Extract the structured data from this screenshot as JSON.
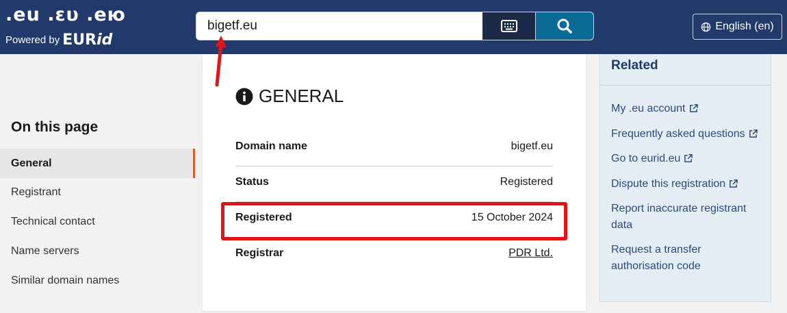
{
  "header": {
    "logo_tlds": ".eu .ευ .ею",
    "logo_powered": "Powered by",
    "logo_brand_main": "EUR",
    "logo_brand_italic": "id",
    "search_value": "bigetf.eu",
    "language_label": "English (en)"
  },
  "nav": {
    "title": "On this page",
    "items": [
      "General",
      "Registrant",
      "Technical contact",
      "Name servers",
      "Similar domain names"
    ],
    "active": "General"
  },
  "general": {
    "title": "GENERAL",
    "rows": [
      {
        "label": "Domain name",
        "value": "bigetf.eu"
      },
      {
        "label": "Status",
        "value": "Registered"
      },
      {
        "label": "Registered",
        "value": "15 October 2024"
      },
      {
        "label": "Registrar",
        "value": "PDR Ltd."
      }
    ]
  },
  "related": {
    "title": "Related",
    "links": [
      "My .eu account",
      "Frequently asked questions",
      "Go to eurid.eu",
      "Dispute this registration",
      "Report inaccurate registrant data",
      "Request a transfer authorisation code"
    ]
  },
  "colors": {
    "header_bg": "#213a6b",
    "search_button": "#0a6a96",
    "keyboard_button": "#1b2a48",
    "active_accent": "#e0592a",
    "annotation_red": "#e31414",
    "related_bg": "#e4ecf4"
  }
}
